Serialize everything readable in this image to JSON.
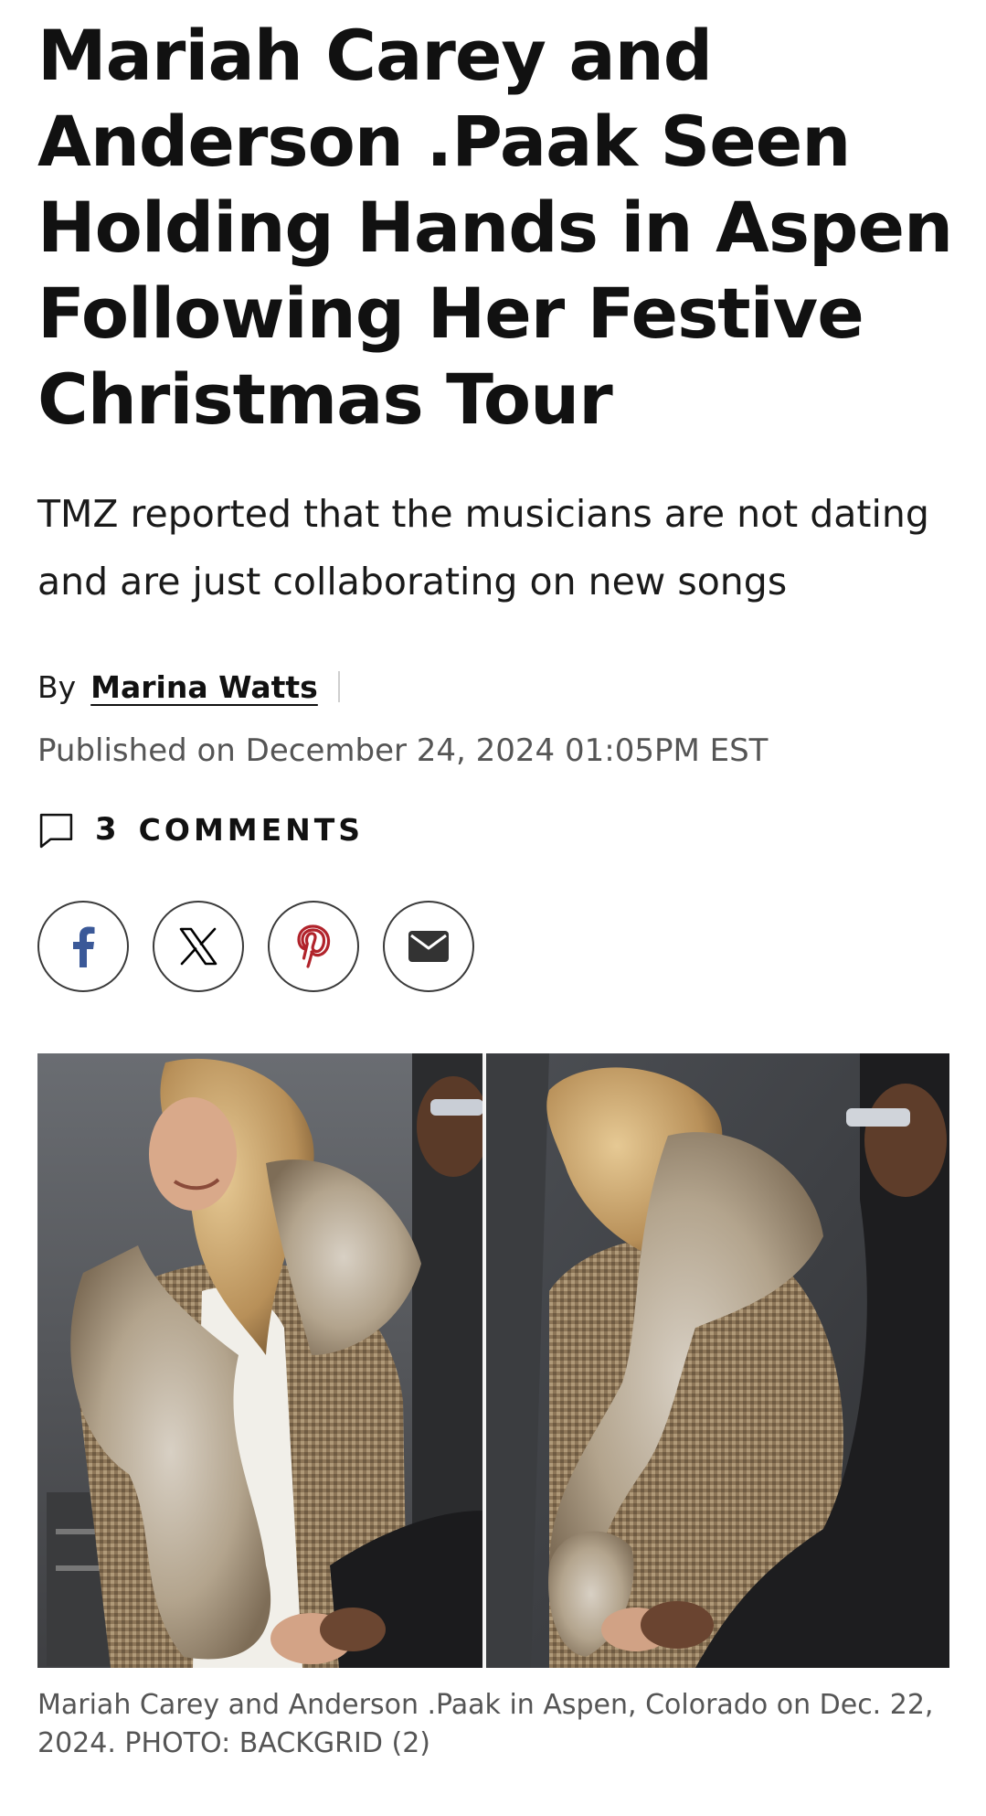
{
  "article": {
    "headline": "Mariah Carey and Anderson .Paak Seen Holding Hands in Aspen Following Her Festive Christmas Tour",
    "dek": "TMZ reported that the musicians are not dating and are just collaborating on new songs",
    "byline_prefix": "By",
    "author": "Marina Watts",
    "published": "Published on December 24, 2024 01:05PM EST",
    "comments_count": "3",
    "comments_label": "COMMENTS"
  },
  "share": {
    "buttons": [
      "facebook-icon",
      "x-icon",
      "pinterest-icon",
      "email-icon"
    ],
    "colors": {
      "facebook": "#3b5998",
      "x": "#000000",
      "pinterest": "#b1232b",
      "email": "#333333"
    }
  },
  "image": {
    "caption": "Mariah Carey and Anderson .Paak in Aspen, Colorado on Dec. 22, 2024. PHOTO: BACKGRID (2)"
  }
}
